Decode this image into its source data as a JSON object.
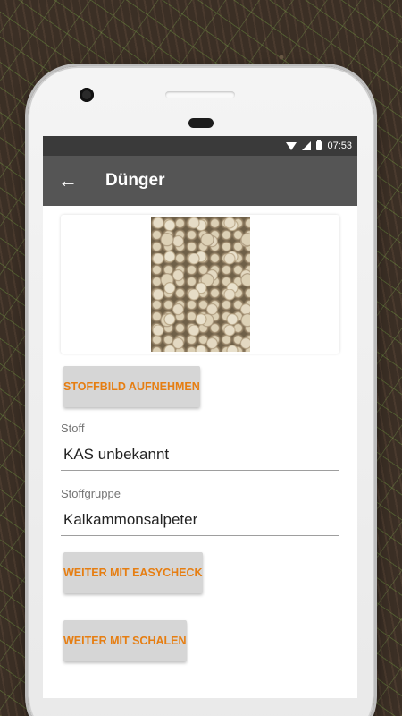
{
  "status_bar": {
    "time": "07:53",
    "icons": [
      "wifi-icon",
      "cell-signal-icon",
      "battery-icon"
    ]
  },
  "app_bar": {
    "back_icon": "arrow-left-icon",
    "title": "Dünger"
  },
  "image_card": {
    "image": "fertilizer-granules-photo"
  },
  "buttons": {
    "take_photo": "STOFFBILD AUFNEHMEN",
    "easycheck": "WEITER MIT EASYCHECK",
    "schalen": "WEITER MIT SCHALEN"
  },
  "fields": {
    "stoff_label": "Stoff",
    "stoff_value": "KAS unbekannt",
    "gruppe_label": "Stoffgruppe",
    "gruppe_value": "Kalkammonsalpeter"
  },
  "colors": {
    "accent": "#e67e12",
    "app_bar": "#555555",
    "status_bar": "#3a3a3a",
    "button_bg": "#d6d6d6"
  }
}
